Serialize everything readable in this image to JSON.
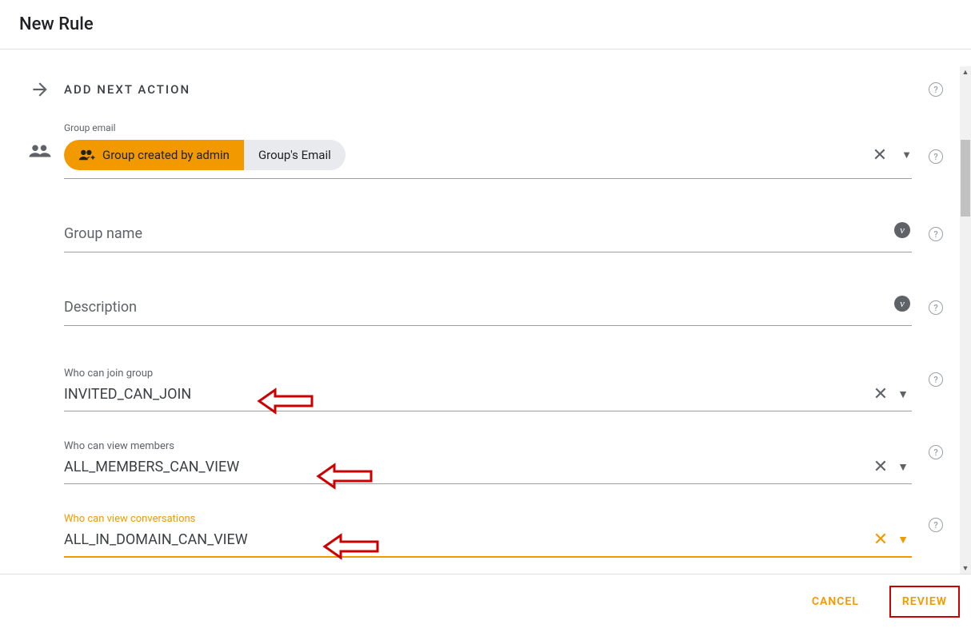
{
  "header": {
    "title": "New Rule"
  },
  "section": {
    "title": "ADD NEXT ACTION"
  },
  "groupEmail": {
    "label": "Group email",
    "chip1": "Group created by admin",
    "chip2": "Group's Email"
  },
  "groupName": {
    "placeholder": "Group name",
    "badge": "v"
  },
  "description": {
    "placeholder": "Description",
    "badge": "v"
  },
  "selects": [
    {
      "label": "Who can join group",
      "value": "INVITED_CAN_JOIN",
      "active": false
    },
    {
      "label": "Who can view members",
      "value": "ALL_MEMBERS_CAN_VIEW",
      "active": false
    },
    {
      "label": "Who can view conversations",
      "value": "ALL_IN_DOMAIN_CAN_VIEW",
      "active": true
    }
  ],
  "footer": {
    "cancel": "CANCEL",
    "review": "REVIEW"
  }
}
